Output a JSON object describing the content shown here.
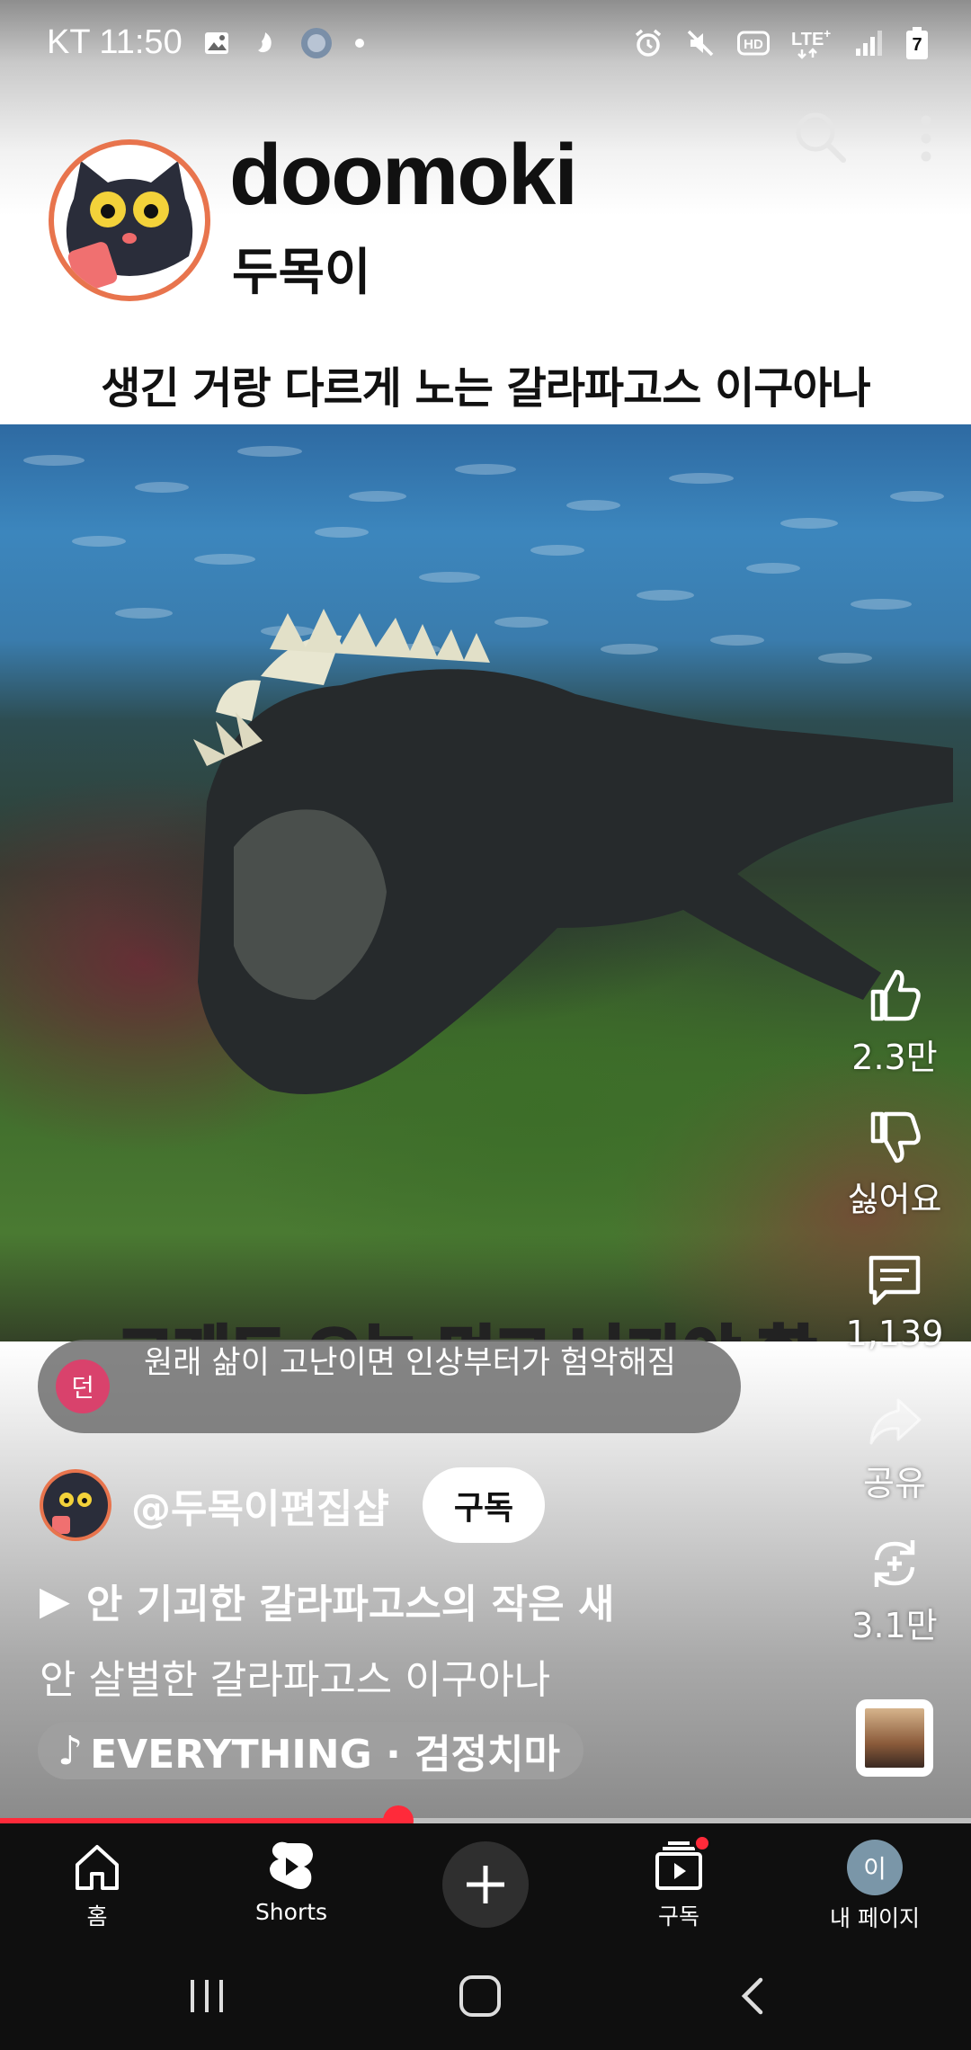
{
  "status_bar": {
    "carrier_time": "KT 11:50",
    "battery_level": "7"
  },
  "channel_header": {
    "name": "doomoki",
    "subtitle": "두목이"
  },
  "video": {
    "caption": "생긴 거랑 다르게 노는 갈라파고스 이구아나",
    "subtitle_overlay": "그래도 오늘 먹고 나가야 함"
  },
  "comment_preview": {
    "avatar_letter": "던",
    "text": "원래 삶이 고난이면 인상부터가 험악해짐"
  },
  "actions": {
    "like_count": "2.3만",
    "dislike_label": "싫어요",
    "comment_count": "1,139",
    "share_label": "공유",
    "remix_count": "3.1만"
  },
  "channel_row": {
    "handle": "@두목이편집샵",
    "subscribe_label": "구독"
  },
  "related_video": {
    "play_glyph": "▶",
    "title": "안 기괴한 갈라파고스의 작은 새"
  },
  "short_title": "안 살벌한 갈라파고스 이구아나",
  "music": {
    "note_glyph": "♪",
    "label": "EVERYTHING · 검정치마"
  },
  "progress": {
    "fraction": 0.41
  },
  "bottom_nav": {
    "home": "홈",
    "shorts": "Shorts",
    "subscriptions": "구독",
    "profile_letter": "이",
    "profile": "내 페이지"
  },
  "colors": {
    "accent_red": "#ff2a3a",
    "avatar_ring": "#e8744d",
    "comment_avatar": "#d9426c"
  }
}
